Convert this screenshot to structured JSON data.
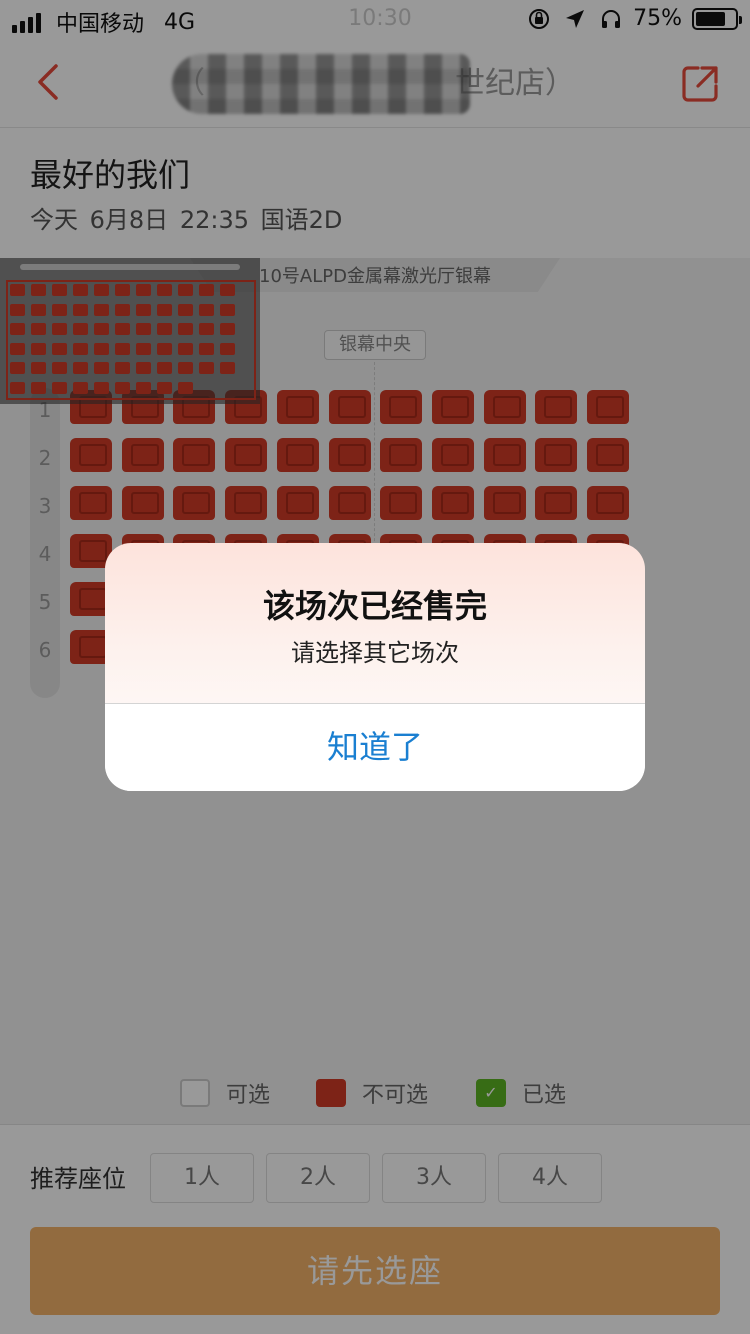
{
  "status_bar": {
    "carrier": "中国移动",
    "network": "4G",
    "time": "10:30",
    "battery": "75%",
    "battery_level": 0.75
  },
  "nav": {
    "cinema_name_suffix": "世纪店）"
  },
  "movie": {
    "title": "最好的我们",
    "day": "今天",
    "date": "6月8日",
    "time": "22:35",
    "format": "国语2D"
  },
  "hall": {
    "screen_label": "10号ALPD金属幕激光厅银幕",
    "center_label": "银幕中央",
    "rows": [
      "1",
      "2",
      "3",
      "4",
      "5",
      "6"
    ],
    "seats_per_row": 11,
    "all_sold": true
  },
  "legend": {
    "available": "可选",
    "sold": "不可选",
    "selected": "已选"
  },
  "recommend": {
    "label": "推荐座位",
    "options": [
      "1人",
      "2人",
      "3人",
      "4人"
    ]
  },
  "confirm_button": "请先选座",
  "alert": {
    "title": "该场次已经售完",
    "message": "请选择其它场次",
    "ok": "知道了"
  },
  "colors": {
    "sold_seat": "#d13b27",
    "selected_seat": "#5db424",
    "accent": "#e64a3b",
    "confirm": "#f4b36a",
    "alert_button": "#1a7fd1"
  }
}
